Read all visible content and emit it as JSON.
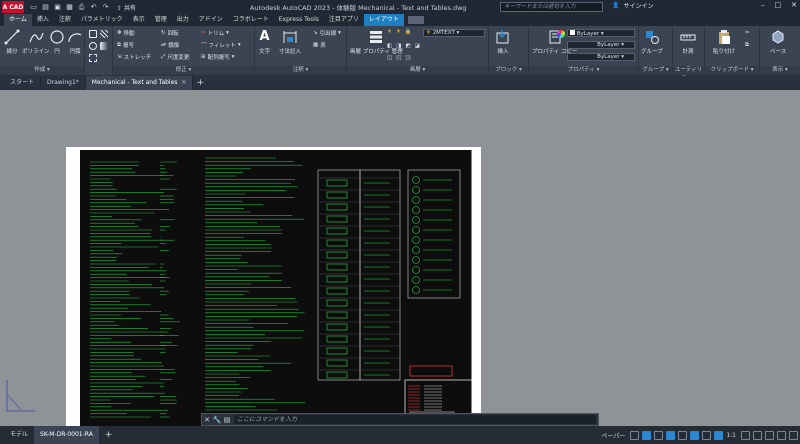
{
  "titlebar": {
    "share": "共有",
    "title": "Autodesk AutoCAD 2023 - 体験版  Mechanical - Text and Tables.dwg",
    "search_placeholder": "キーワードまたは語句を入力",
    "signin": "サインイン"
  },
  "ribbon_tabs": [
    "ホーム",
    "挿入",
    "注釈",
    "パラメトリック",
    "表示",
    "管理",
    "出力",
    "アドイン",
    "コラボレート",
    "Express Tools",
    "注目アプリ",
    "レイアウト"
  ],
  "ribbon": {
    "draw": {
      "title": "作成",
      "line": "線分",
      "polyline": "ポリライン",
      "circle": "円",
      "arc": "円弧"
    },
    "modify": {
      "title": "修正",
      "move": "移動",
      "rotate": "回転",
      "trim": "トリム",
      "copy": "複写",
      "mirror": "鏡像",
      "fillet": "フィレット",
      "stretch": "ストレッチ",
      "scale": "尺度変更",
      "array": "配列複写"
    },
    "annotation": {
      "title": "注釈",
      "text": "文字",
      "dimension": "寸法記入",
      "leader": "引出線",
      "table": "表"
    },
    "layers": {
      "title": "画層",
      "layer_props": "画層 プロパティ 管理",
      "current_layer": "2MTEXT"
    },
    "block": {
      "title": "ブロック",
      "insert": "挿入"
    },
    "properties": {
      "title": "プロパティ",
      "copy_props": "プロパティ コピー",
      "color": "ByLayer",
      "linetype": "ByLayer",
      "lineweight": "ByLayer"
    },
    "groups": {
      "title": "グループ",
      "group": "グループ"
    },
    "utilities": {
      "title": "ユーティリティ",
      "measure": "計測"
    },
    "clipboard": {
      "title": "クリップボード",
      "paste": "貼り付け"
    },
    "view": {
      "title": "表示",
      "base": "ベース"
    }
  },
  "file_tabs": [
    {
      "label": "スタート"
    },
    {
      "label": "Drawing1*"
    },
    {
      "label": "Mechanical - Text and Tables"
    }
  ],
  "command_line": {
    "placeholder": "ここにコマンドを入力"
  },
  "status": {
    "layout_tabs": [
      "モデル",
      "SK-M-DR-0001-RA"
    ],
    "paper": "ペーパー",
    "scale": "1:1"
  },
  "colors": {
    "accent": "#1d80c3",
    "brand": "#c8102e",
    "drawing_line": "#2bd84b"
  }
}
